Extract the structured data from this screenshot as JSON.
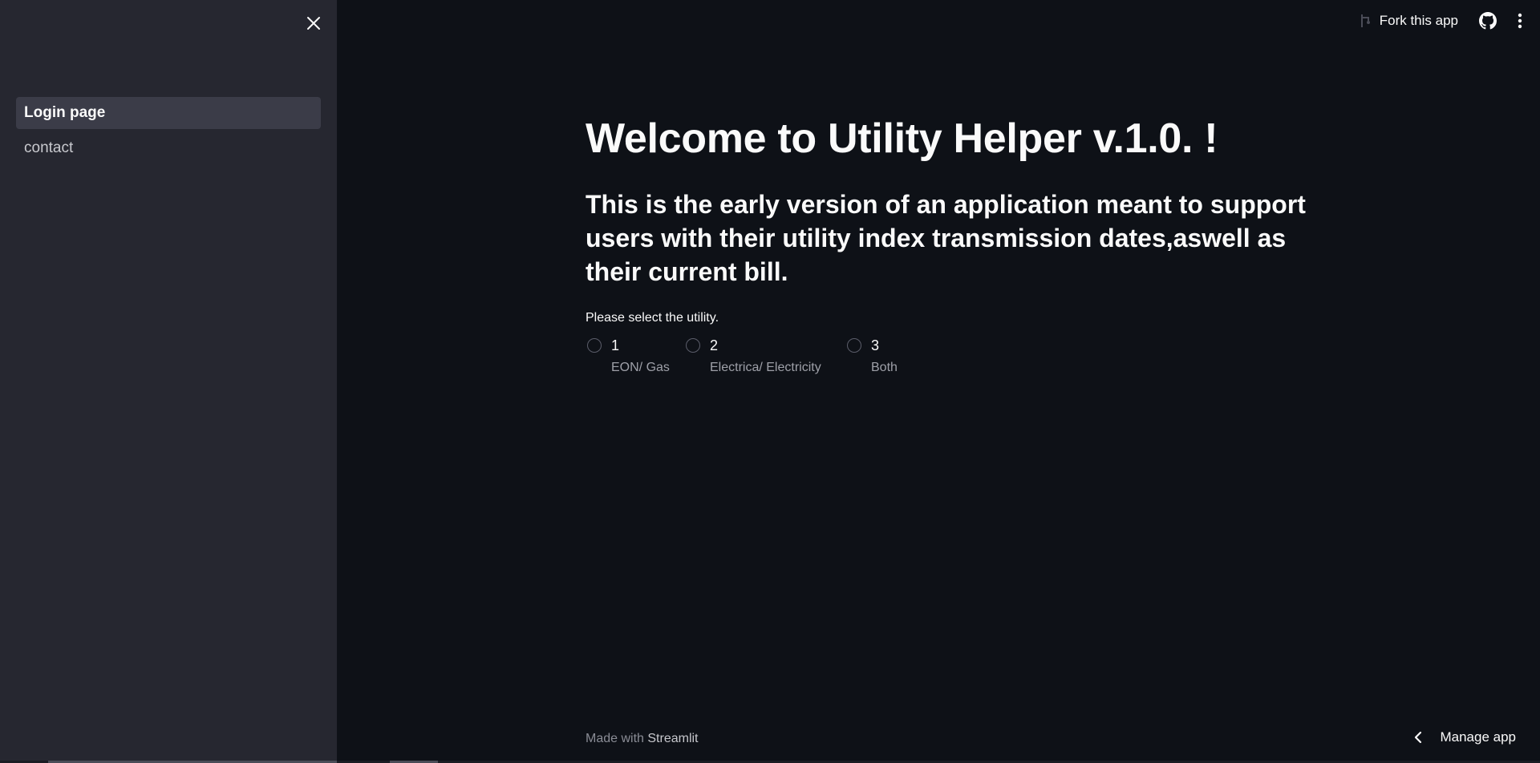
{
  "sidebar": {
    "items": [
      {
        "label": "Login page",
        "active": true
      },
      {
        "label": "contact",
        "active": false
      }
    ]
  },
  "topbar": {
    "fork_label": "Fork this app",
    "icons": [
      "fork-icon",
      "github-icon",
      "kebab-menu-icon"
    ]
  },
  "main": {
    "title": "Welcome to Utility Helper v.1.0. !",
    "subtitle": "This is the early version of an application meant to support users with their utility index transmission dates,aswell as their current bill.",
    "radio": {
      "label": "Please select the utility.",
      "options": [
        {
          "value": "1",
          "caption": "EON/ Gas"
        },
        {
          "value": "2",
          "caption": "Electrica/ Electricity"
        },
        {
          "value": "3",
          "caption": "Both"
        }
      ]
    }
  },
  "footer": {
    "made_with": "Made with",
    "brand": "Streamlit"
  },
  "manage_app": {
    "label": "Manage app"
  },
  "colors": {
    "background": "#0e1117",
    "sidebar": "#262730",
    "active_nav": "#3b3c48",
    "text": "#fafafa"
  }
}
